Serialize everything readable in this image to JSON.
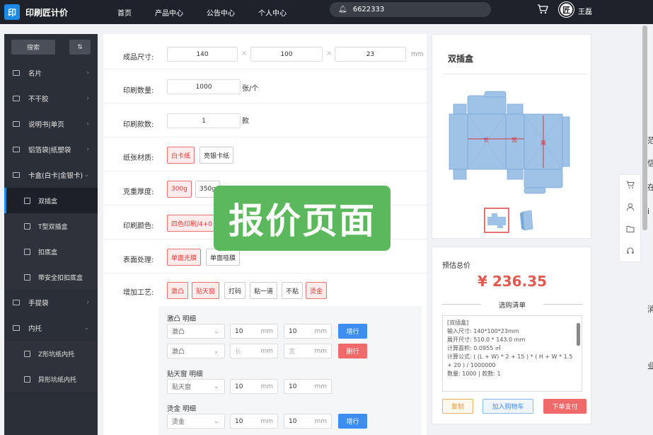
{
  "header": {
    "logo_char": "印",
    "app_title": "印刷匠计价",
    "nav": [
      "首页",
      "产品中心",
      "公告中心",
      "个人中心"
    ],
    "search_value": "6622333",
    "avatar_char": "匠",
    "username": "王磊"
  },
  "sidebar": {
    "search_label": "搜索",
    "sort_label": "⇅",
    "items": [
      {
        "label": "名片"
      },
      {
        "label": "不干胶"
      },
      {
        "label": "说明书|单页"
      },
      {
        "label": "铝箔袋|纸塑袋"
      },
      {
        "label": "卡盒(白卡|金银卡)"
      }
    ],
    "box_children": [
      "双插盒",
      "T型双插盒",
      "扣底盒",
      "带安全扣扣底盒"
    ],
    "items_after": [
      {
        "label": "手提袋"
      },
      {
        "label": "内托"
      }
    ],
    "tray_children": [
      "Z形坑纸内托",
      "异形坑纸内托"
    ]
  },
  "form": {
    "size": {
      "label": "成品尺寸:",
      "l": "140",
      "w": "100",
      "h": "23",
      "unit": "mm"
    },
    "qty": {
      "label": "印刷数量:",
      "value": "1000",
      "unit": "张/个"
    },
    "styles": {
      "label": "印刷款数:",
      "value": "1",
      "unit": "款"
    },
    "paper": {
      "label": "纸张材质:",
      "options": [
        "白卡纸",
        "亮银卡纸"
      ]
    },
    "weight": {
      "label": "克重厚度:",
      "options": [
        "300g",
        "350g"
      ]
    },
    "color": {
      "label": "印刷颜色:",
      "options": [
        "四色印刷/4+0"
      ]
    },
    "surface": {
      "label": "表面处理:",
      "options": [
        "单面光膜",
        "单面哑膜"
      ]
    },
    "craft": {
      "label": "增加工艺:",
      "options": [
        "激凸",
        "贴天窗",
        "打码",
        "粘一道",
        "不粘",
        "烫金"
      ]
    },
    "details": {
      "emboss_title": "激凸 明细",
      "emboss_row1": {
        "type": "激凸",
        "len": "10",
        "wid": "10",
        "unit": "mm",
        "action": "增行"
      },
      "emboss_row2": {
        "type": "激凸",
        "len_ph": "长",
        "wid_ph": "宽",
        "unit": "mm",
        "action": "删行"
      },
      "window_title": "贴天窗 明细",
      "window_row": {
        "type": "贴天窗",
        "len": "10",
        "wid": "10",
        "unit": "mm"
      },
      "foil_title": "烫金 明细",
      "foil_row": {
        "type": "烫金",
        "len": "10",
        "wid": "10",
        "unit": "mm",
        "action": "增行"
      }
    }
  },
  "overlay": {
    "text": "报价页面"
  },
  "product": {
    "title": "双插盒",
    "dim_long": "长",
    "dim_wide": "宽",
    "dim_high": "高"
  },
  "price": {
    "label": "预估总价",
    "value": "¥ 236.35",
    "list_title": "选购清单",
    "lines": [
      "[双插盒]",
      "输入尺寸: 140*100*23mm",
      "展开尺寸: 510.0 * 143.0 mm",
      "计算面积: 0.0955 ㎡",
      "计算公式: ( (L + W) * 2 + 15 ) * ( H + W * 1.5 + 20 ) / 1000000",
      "数量: 1000 | 款数: 1"
    ],
    "btn_copy": "复制",
    "btn_cart": "加入购物车",
    "btn_order": "下单支付"
  },
  "edge": {
    "chars": [
      "范",
      "信",
      "在",
      "i",
      "消",
      "业"
    ]
  },
  "colors": {
    "accent": "#1e88e5",
    "selected": "#e53935",
    "price": "#e05a4f",
    "overlay": "#5cb85c"
  }
}
